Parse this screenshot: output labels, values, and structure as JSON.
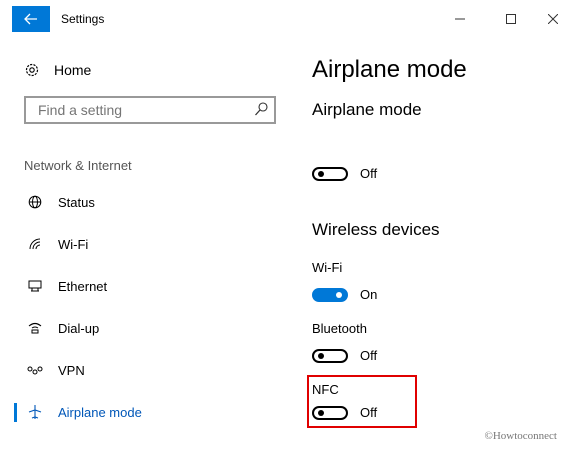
{
  "titlebar": {
    "title": "Settings",
    "back_icon": "arrow-left-icon"
  },
  "sidebar": {
    "home_label": "Home",
    "search_placeholder": "Find a setting",
    "section_label": "Network & Internet",
    "items": [
      {
        "label": "Status",
        "icon": "globe-icon",
        "active": false
      },
      {
        "label": "Wi-Fi",
        "icon": "wifi-icon",
        "active": false
      },
      {
        "label": "Ethernet",
        "icon": "ethernet-icon",
        "active": false
      },
      {
        "label": "Dial-up",
        "icon": "dialup-icon",
        "active": false
      },
      {
        "label": "VPN",
        "icon": "vpn-icon",
        "active": false
      },
      {
        "label": "Airplane mode",
        "icon": "airplane-icon",
        "active": true
      }
    ]
  },
  "main": {
    "page_title": "Airplane mode",
    "airplane_header": "Airplane mode",
    "airplane_toggle_state": "Off",
    "wireless_header": "Wireless devices",
    "wifi_label": "Wi-Fi",
    "wifi_state": "On",
    "bluetooth_label": "Bluetooth",
    "bluetooth_state": "Off",
    "nfc_label": "NFC",
    "nfc_state": "Off"
  },
  "watermark": "©Howtoconnect",
  "colors": {
    "accent": "#0078d7",
    "highlight": "#e00000"
  }
}
